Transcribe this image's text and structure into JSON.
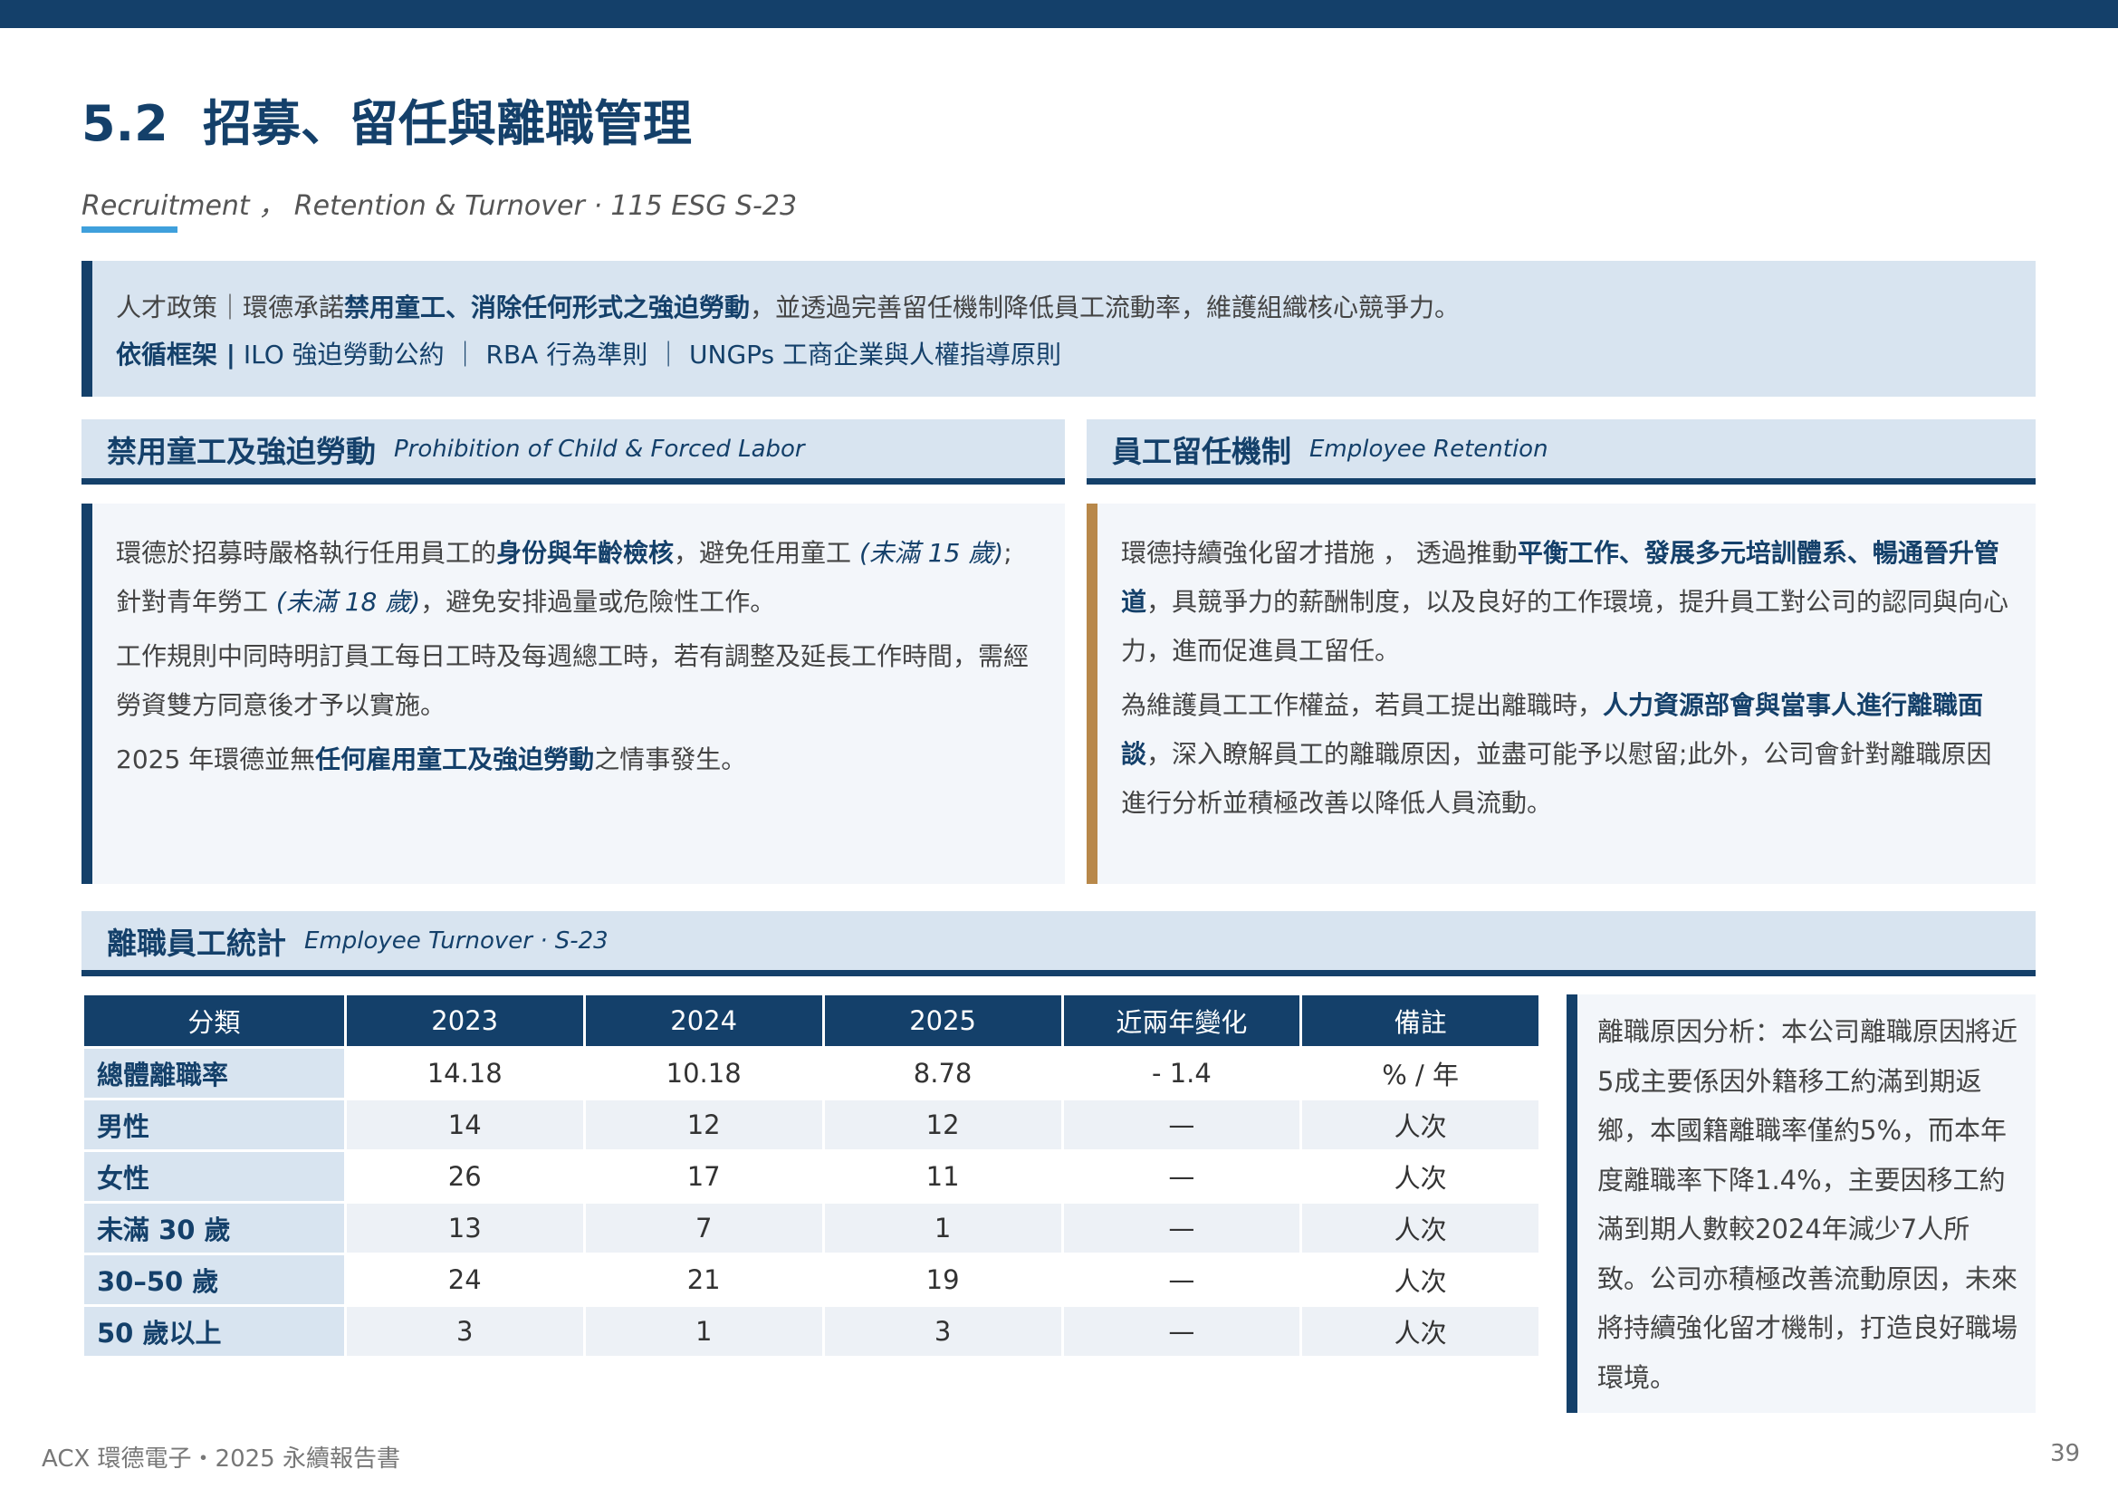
{
  "header": {
    "section_number": "5.2",
    "title": "招募、留任與離職管理",
    "subtitle": "Recruitment ， Retention & Turnover · 115 ESG S-23"
  },
  "policy": {
    "line1_prefix": "人才政策｜環德承諾",
    "line1_bold": "禁用童工、消除任何形式之強迫勞動",
    "line1_suffix": "，並透過完善留任機制降低員工流動率，維護組織核心競爭力。",
    "line2_label": "依循框架 |",
    "line2_text": " ILO 強迫勞動公約 ｜ RBA 行為準則 ｜ UNGPs 工商企業與人權指導原則"
  },
  "left_section": {
    "title": "禁用童工及強迫勞動",
    "title_en": "Prohibition of Child & Forced Labor",
    "p1_a": "環德於招募時嚴格執行任用員工的",
    "p1_b": "身份與年齡檢核",
    "p1_c": "，避免任用童工 ",
    "p1_d": "(未滿 15 歲)",
    "p1_e": "; 針對青年勞工 ",
    "p1_f": "(未滿 18 歲)",
    "p1_g": "，避免安排過量或危險性工作。",
    "p2": "工作規則中同時明訂員工每日工時及每週總工時，若有調整及延長工作時間，需經勞資雙方同意後才予以實施。",
    "p3_a": "2025 年環德並無",
    "p3_b": "任何雇用童工及強迫勞動",
    "p3_c": "之情事發生。"
  },
  "right_section": {
    "title": "員工留任機制",
    "title_en": "Employee Retention",
    "p1_a": "環德持續強化留才措施 ， 透過推動",
    "p1_b": "平衡工作、發展多元培訓體系、暢通晉升管道",
    "p1_c": "，具競爭力的薪酬制度，以及良好的工作環境，提升員工對公司的認同與向心力，進而促進員工留任。",
    "p2_a": "為維護員工工作權益，若員工提出離職時，",
    "p2_b": "人力資源部會與當事人進行離職面談",
    "p2_c": "，深入瞭解員工的離職原因，並盡可能予以慰留;此外，公司會針對離職原因進行分析並積極改善以降低人員流動。"
  },
  "turnover_section": {
    "title": "離職員工統計",
    "title_en": "Employee Turnover · S-23"
  },
  "table": {
    "headers": [
      "分類",
      "2023",
      "2024",
      "2025",
      "近兩年變化",
      "備註"
    ],
    "rows": [
      [
        "總體離職率",
        "14.18",
        "10.18",
        "8.78",
        "- 1.4",
        "% / 年"
      ],
      [
        "男性",
        "14",
        "12",
        "12",
        "—",
        "人次"
      ],
      [
        "女性",
        "26",
        "17",
        "11",
        "—",
        "人次"
      ],
      [
        "未滿 30 歲",
        "13",
        "7",
        "1",
        "—",
        "人次"
      ],
      [
        "30–50 歲",
        "24",
        "21",
        "19",
        "—",
        "人次"
      ],
      [
        "50 歲以上",
        "3",
        "1",
        "3",
        "—",
        "人次"
      ]
    ]
  },
  "note": {
    "text": "離職原因分析：本公司離職原因將近5成主要係因外籍移工約滿到期返鄉，本國籍離職率僅約5%，而本年度離職率下降1.4%，主要因移工約滿到期人數較2024年減少7人所致。公司亦積極改善流動原因，未來將持續強化留才機制，打造良好職場環境。"
  },
  "footer": {
    "left": "ACX 環德電子・2025 永續報告書",
    "page": "39"
  },
  "colors": {
    "primary": "#14406a",
    "light_panel": "#d8e4f0",
    "accent_blue": "#3fa0dc",
    "accent_gold": "#b8884a"
  }
}
